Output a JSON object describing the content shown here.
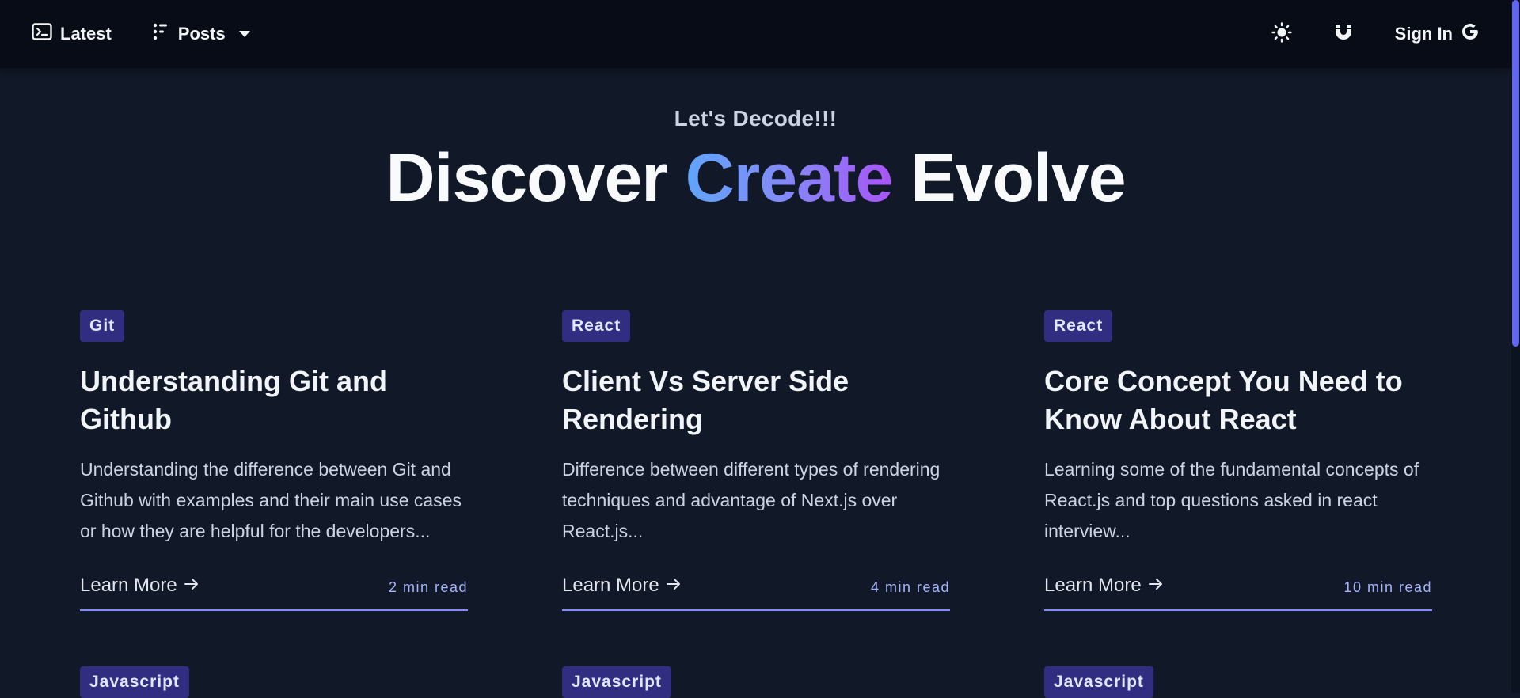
{
  "nav": {
    "latest_label": "Latest",
    "posts_label": "Posts",
    "sign_in_label": "Sign In"
  },
  "hero": {
    "tagline": "Let's Decode!!!",
    "headline_word1": "Discover",
    "headline_word2": "Create",
    "headline_word3": "Evolve"
  },
  "colors": {
    "background": "#111827",
    "navbar": "#070c16",
    "badge": "#312e81",
    "accent": "#818cf8",
    "gradient": [
      "#60a5fa",
      "#818cf8",
      "#a855f7"
    ]
  },
  "icons": {
    "latest": "terminal-icon",
    "posts": "list-icon",
    "posts_dropdown": "caret-down-icon",
    "theme": "sun-icon",
    "magnet": "magnet-icon",
    "sign_in": "google-icon",
    "learn_more": "arrow-right-icon"
  },
  "posts": [
    {
      "tag": "Git",
      "title": "Understanding Git and Github",
      "description": "Understanding the difference between Git and Github with examples and their main use cases or how they are helpful for the developers...",
      "cta": "Learn More",
      "read_time": "2 min read"
    },
    {
      "tag": "React",
      "title": "Client Vs Server Side Rendering",
      "description": "Difference between different types of rendering techniques and advantage of Next.js over React.js...",
      "cta": "Learn More",
      "read_time": "4 min read"
    },
    {
      "tag": "React",
      "title": "Core Concept You Need to Know About React",
      "description": "Learning some of the fundamental concepts of React.js and top questions asked in react interview...",
      "cta": "Learn More",
      "read_time": "10 min read"
    },
    {
      "tag": "Javascript"
    },
    {
      "tag": "Javascript"
    },
    {
      "tag": "Javascript"
    }
  ]
}
